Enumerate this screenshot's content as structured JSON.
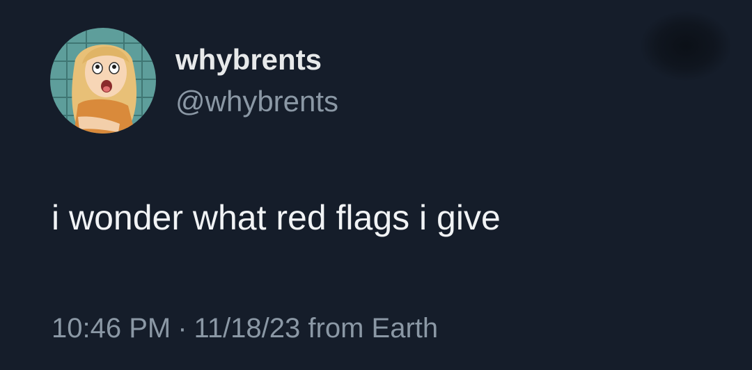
{
  "tweet": {
    "author": {
      "display_name": "whybrents",
      "handle": "@whybrents",
      "avatar_icon": "cartoon-girl-avatar"
    },
    "text": "i wonder what red flags i give",
    "timestamp": {
      "time": "10:46 PM",
      "separator": "·",
      "date": "11/18/23",
      "source": "from Earth"
    }
  },
  "colors": {
    "background": "#151d2a",
    "primary_text": "#e7e9ea",
    "secondary_text": "#8b98a5"
  }
}
